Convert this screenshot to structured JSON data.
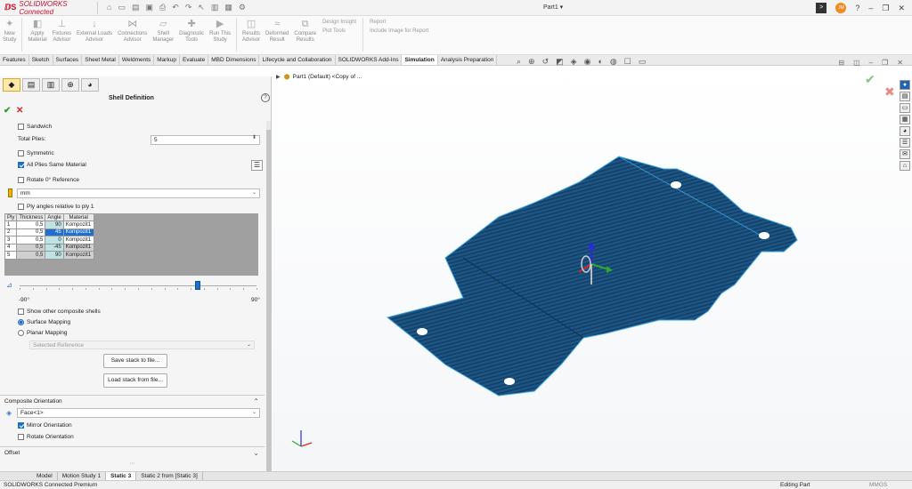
{
  "app": {
    "brand": "SOLIDWORKS Connected",
    "doc_title": "Part1 ▾",
    "avatar_initials": "JM"
  },
  "ribbon": {
    "buttons": [
      {
        "label": "New\nStudy",
        "icon": "new-study-icon"
      },
      {
        "label": "Apply\nMaterial",
        "icon": "apply-material-icon"
      },
      {
        "label": "Fixtures\nAdvisor",
        "icon": "fixtures-advisor-icon"
      },
      {
        "label": "External Loads\nAdvisor",
        "icon": "external-loads-icon"
      },
      {
        "label": "Connections\nAdvisor",
        "icon": "connections-icon"
      },
      {
        "label": "Shell\nManager",
        "icon": "shell-manager-icon"
      },
      {
        "label": "Diagnostic\nTools",
        "icon": "diagnostic-tools-icon"
      },
      {
        "label": "Run This\nStudy",
        "icon": "run-study-icon"
      },
      {
        "label": "Results\nAdvisor",
        "icon": "results-advisor-icon"
      },
      {
        "label": "Deformed\nResult",
        "icon": "deformed-result-icon"
      },
      {
        "label": "Compare\nResults",
        "icon": "compare-results-icon"
      }
    ],
    "insight": [
      "Design Insight",
      "Plot Tools"
    ],
    "report": [
      "Report",
      "Include Image for Report"
    ]
  },
  "command_tabs": [
    {
      "label": "Features",
      "active": false
    },
    {
      "label": "Sketch",
      "active": false
    },
    {
      "label": "Surfaces",
      "active": false
    },
    {
      "label": "Sheet Metal",
      "active": false
    },
    {
      "label": "Weldments",
      "active": false
    },
    {
      "label": "Markup",
      "active": false
    },
    {
      "label": "Evaluate",
      "active": false
    },
    {
      "label": "MBD Dimensions",
      "active": false
    },
    {
      "label": "Lifecycle and Collaboration",
      "active": false
    },
    {
      "label": "SOLIDWORKS Add-Ins",
      "active": false
    },
    {
      "label": "Simulation",
      "active": true
    },
    {
      "label": "Analysis Preparation",
      "active": false
    }
  ],
  "property_manager": {
    "title": "Shell Definition",
    "sandwich": {
      "label": "Sandwich",
      "checked": false
    },
    "total_plies": {
      "label": "Total Plies:",
      "value": "5"
    },
    "symmetric": {
      "label": "Symmetric",
      "checked": false
    },
    "all_plies_same": {
      "label": "All Plies Same Material",
      "checked": true
    },
    "rotate_ref": {
      "label": "Rotate 0° Reference",
      "checked": false
    },
    "units": {
      "value": "mm"
    },
    "ply_relative": {
      "label": "Ply angles relative to ply 1",
      "checked": false
    },
    "ply_table": {
      "headers": [
        "Ply",
        "Thickness",
        "Angle",
        "Material"
      ],
      "rows": [
        {
          "ply": "1",
          "thickness": "0,5",
          "angle": "90",
          "material": "Kompozit1",
          "selected": false
        },
        {
          "ply": "2",
          "thickness": "0,5",
          "angle": "45",
          "material": "Kompozit1",
          "selected": true
        },
        {
          "ply": "3",
          "thickness": "0,5",
          "angle": "0",
          "material": "Kompozit1",
          "selected": false
        },
        {
          "ply": "4",
          "thickness": "0,5",
          "angle": "-45",
          "material": "Kompozit1",
          "selected": false
        },
        {
          "ply": "5",
          "thickness": "0,5",
          "angle": "90",
          "material": "Kompozit1",
          "selected": false
        }
      ]
    },
    "angle_slider": {
      "min_label": "-90°",
      "max_label": "90°",
      "value_deg": 45
    },
    "show_other": {
      "label": "Show other composite shells",
      "checked": false
    },
    "surface_mapping": {
      "label": "Surface Mapping",
      "selected": true
    },
    "planar_mapping": {
      "label": "Planar Mapping",
      "selected": false
    },
    "selected_reference": {
      "placeholder": "Selected Reference"
    },
    "save_stack": "Save stack to file...",
    "load_stack": "Load stack from file...",
    "composite_orientation": {
      "header": "Composite Orientation",
      "face": "Face<1>",
      "mirror": {
        "label": "Mirror Orientation",
        "checked": true
      },
      "rotate": {
        "label": "Rotate Orientation",
        "checked": false
      }
    },
    "offset": {
      "header": "Offset"
    }
  },
  "graphics": {
    "tree_node": "Part1 (Default) <Copy of ...",
    "model_color": "#1a4e7a",
    "edge_color": "#2e9ad8"
  },
  "bottom_tabs": [
    {
      "label": "Model",
      "active": false
    },
    {
      "label": "Motion Study 1",
      "active": false
    },
    {
      "label": "Static 3",
      "active": true
    },
    {
      "label": "Static 2 from [Static 3]",
      "active": false
    }
  ],
  "status": {
    "left": "SOLIDWORKS Connected Premium",
    "editing": "Editing Part",
    "units": "MMGS"
  }
}
